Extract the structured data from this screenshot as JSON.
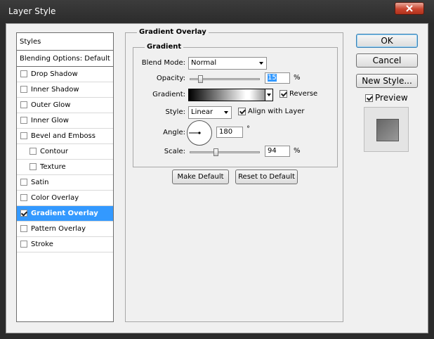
{
  "window": {
    "title": "Layer Style"
  },
  "sidebar": {
    "header": "Styles",
    "blending": "Blending Options: Default",
    "items": [
      {
        "label": "Drop Shadow",
        "checked": false
      },
      {
        "label": "Inner Shadow",
        "checked": false
      },
      {
        "label": "Outer Glow",
        "checked": false
      },
      {
        "label": "Inner Glow",
        "checked": false
      },
      {
        "label": "Bevel and Emboss",
        "checked": false
      },
      {
        "label": "Contour",
        "checked": false
      },
      {
        "label": "Texture",
        "checked": false
      },
      {
        "label": "Satin",
        "checked": false
      },
      {
        "label": "Color Overlay",
        "checked": false
      },
      {
        "label": "Gradient Overlay",
        "checked": true
      },
      {
        "label": "Pattern Overlay",
        "checked": false
      },
      {
        "label": "Stroke",
        "checked": false
      }
    ]
  },
  "panel": {
    "title": "Gradient Overlay",
    "group_title": "Gradient",
    "blend_mode": {
      "label": "Blend Mode:",
      "value": "Normal"
    },
    "opacity": {
      "label": "Opacity:",
      "value": "15",
      "unit": "%",
      "fraction": 0.15
    },
    "gradient": {
      "label": "Gradient:",
      "reverse_label": "Reverse",
      "reverse_checked": true
    },
    "style": {
      "label": "Style:",
      "value": "Linear",
      "align_label": "Align with Layer",
      "align_checked": true
    },
    "angle": {
      "label": "Angle:",
      "value": "180",
      "unit": "°"
    },
    "scale": {
      "label": "Scale:",
      "value": "94",
      "unit": "%",
      "fraction": 0.37
    },
    "make_default": "Make Default",
    "reset_default": "Reset to Default"
  },
  "buttons": {
    "ok": "OK",
    "cancel": "Cancel",
    "new_style": "New Style...",
    "preview_label": "Preview",
    "preview_checked": true
  },
  "colors": {
    "selection": "#3399ff",
    "close": "#c9452f"
  }
}
